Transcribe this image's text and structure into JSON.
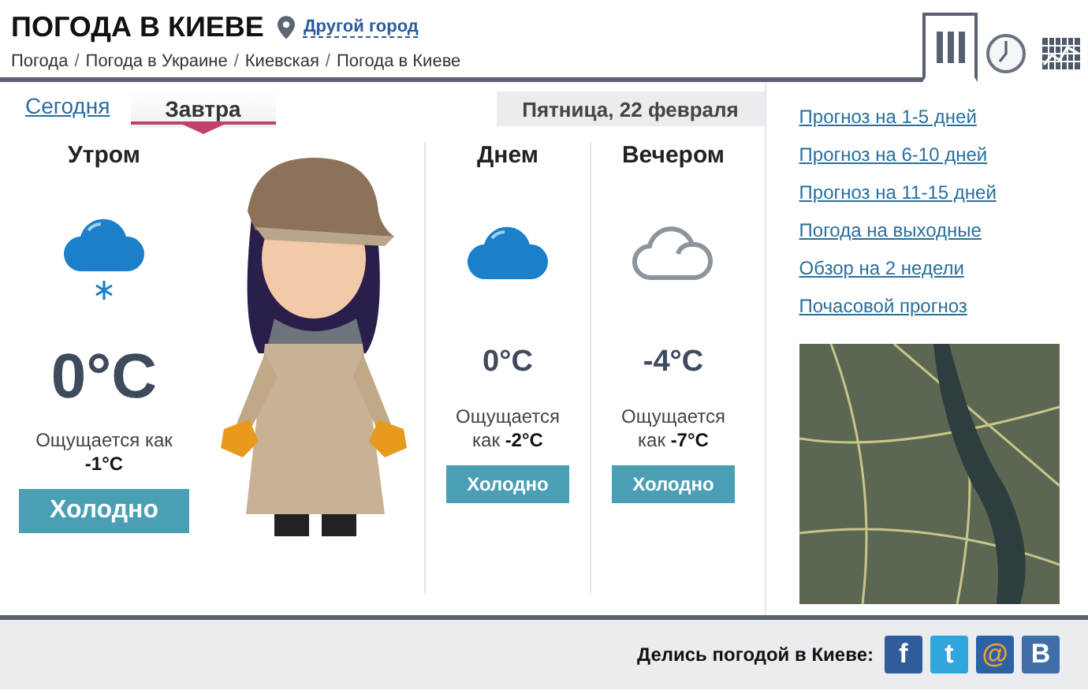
{
  "header": {
    "title": "ПОГОДА В КИЕВЕ",
    "change_city": "Другой город"
  },
  "view_tabs": [
    {
      "kind": "columns",
      "selected": true
    },
    {
      "kind": "clock",
      "selected": false
    },
    {
      "kind": "grid",
      "selected": false
    }
  ],
  "breadcrumbs": [
    "Погода",
    "Погода в Украине",
    "Киевская",
    "Погода в Киеве"
  ],
  "breadcrumb_separator": "/",
  "day_tabs": [
    {
      "label": "Сегодня",
      "selected": false
    },
    {
      "label": "Завтра",
      "selected": true
    }
  ],
  "date": "Пятница, 22 февраля",
  "periods": [
    {
      "name": "Утром",
      "kind": "large",
      "icon": {
        "kind": "snow-cloud"
      },
      "temperature": "0°C",
      "feels_label": "Ощущается как",
      "feels_value": "-1°C",
      "verdict": "Холодно"
    },
    {
      "name": "Днем",
      "kind": "small",
      "icon": {
        "kind": "cloud"
      },
      "temperature": "0°C",
      "feels_label": "Ощущается как",
      "feels_value": "-2°C",
      "verdict": "Холодно"
    },
    {
      "name": "Вечером",
      "kind": "small",
      "icon": {
        "kind": "cloud-outline"
      },
      "temperature": "-4°C",
      "feels_label": "Ощущается как",
      "feels_value": "-7°C",
      "verdict": "Холодно"
    }
  ],
  "links": [
    "Прогноз на 1-5 дней",
    "Прогноз на 6-10 дней",
    "Прогноз на 11-15 дней",
    "Погода на выходные",
    "Обзор на 2 недели",
    "Почасовой прогноз"
  ],
  "share": {
    "label": "Делись погодой в Киеве:",
    "buttons": [
      {
        "glyph": "f",
        "color": "#2f5d9b",
        "kind": "plain"
      },
      {
        "glyph": "t",
        "color": "#31a6dc",
        "kind": "plain"
      },
      {
        "glyph": "@",
        "color": "#2b62a6",
        "kind": "accent"
      },
      {
        "glyph": "B",
        "color": "#3f6ea8",
        "kind": "plain"
      }
    ]
  }
}
